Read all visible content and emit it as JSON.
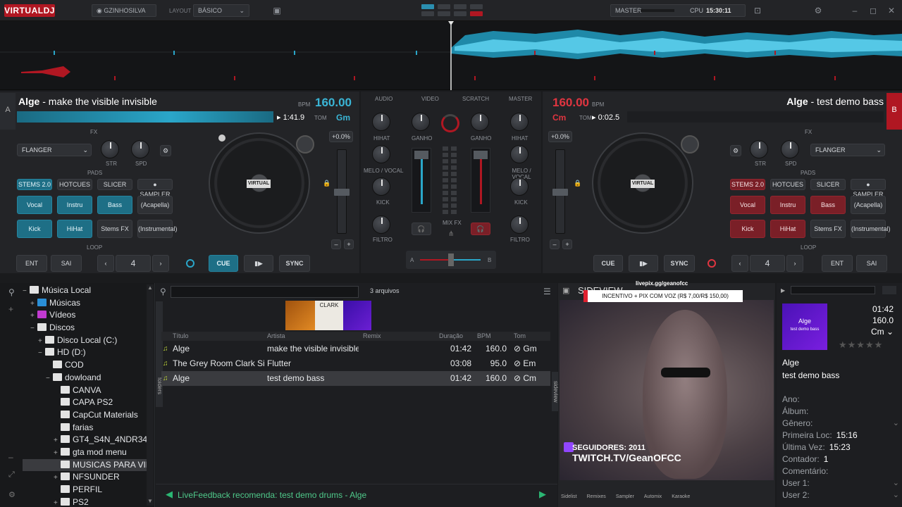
{
  "app": {
    "logo": "VIRTUALDJ"
  },
  "topbar": {
    "user": "GZINHOSILVA",
    "layout_label": "LAYOUT",
    "layout_value": "BÁSICO",
    "master_label": "MASTER",
    "cpu_label": "CPU",
    "clock": "15:30:11"
  },
  "deckA": {
    "letter": "A",
    "artist": "Alge",
    "title": " - make the visible invisible",
    "bpm_label": "BPM",
    "bpm": "160.00",
    "time": "1:41.9",
    "key_label": "TOM",
    "key": "Gm",
    "pitch": "+0.0%",
    "fx_label": "FX",
    "fx_effect": "FLANGER",
    "str": "STR",
    "spd": "SPD",
    "pads_label": "PADS",
    "pad_modes": [
      "STEMS 2.0",
      "HOTCUES",
      "SLICER",
      "SAMPLER"
    ],
    "pads": [
      "Vocal",
      "Instru",
      "Bass",
      "(Acapella)",
      "Kick",
      "HiHat",
      "Stems FX",
      "(Instrumental)"
    ],
    "loop_label": "LOOP",
    "ent": "ENT",
    "sai": "SAI",
    "loop_size": "4",
    "cue": "CUE",
    "sync": "SYNC"
  },
  "deckB": {
    "letter": "B",
    "artist": "Alge",
    "title": " - test demo bass",
    "bpm_label": "BPM",
    "bpm": "160.00",
    "time": "0:02.5",
    "key_label": "TOM",
    "key": "Cm",
    "pitch": "+0.0%",
    "fx_label": "FX",
    "fx_effect": "FLANGER",
    "str": "STR",
    "spd": "SPD",
    "pads_label": "PADS",
    "pad_modes": [
      "STEMS 2.0",
      "HOTCUES",
      "SLICER",
      "SAMPLER"
    ],
    "pads": [
      "Vocal",
      "Instru",
      "Bass",
      "(Acapella)",
      "Kick",
      "HiHat",
      "Stems FX",
      "(Instrumental)"
    ],
    "loop_label": "LOOP",
    "ent": "ENT",
    "sai": "SAI",
    "loop_size": "4",
    "cue": "CUE",
    "sync": "SYNC"
  },
  "mixer": {
    "tabs": [
      "AUDIO",
      "VIDEO",
      "SCRATCH",
      "MASTER"
    ],
    "hihat": "HIHAT",
    "ganho": "GANHO",
    "melo": "MELO / VOCAL",
    "kick": "KICK",
    "filtro": "FILTRO",
    "mixfx": "MIX FX",
    "cross_a": "A",
    "cross_b": "B"
  },
  "browser": {
    "tree": [
      {
        "label": "Música Local",
        "indent": 0,
        "exp": "−"
      },
      {
        "label": "Músicas",
        "indent": 1,
        "exp": "+"
      },
      {
        "label": "Vídeos",
        "indent": 1,
        "exp": "+"
      },
      {
        "label": "Discos",
        "indent": 1,
        "exp": "−"
      },
      {
        "label": "Disco Local (C:)",
        "indent": 2,
        "exp": "+"
      },
      {
        "label": "HD (D:)",
        "indent": 2,
        "exp": "−"
      },
      {
        "label": "COD",
        "indent": 3,
        "exp": ""
      },
      {
        "label": "dowloand",
        "indent": 3,
        "exp": "−"
      },
      {
        "label": "CANVA",
        "indent": 4,
        "exp": ""
      },
      {
        "label": "CAPA PS2",
        "indent": 4,
        "exp": ""
      },
      {
        "label": "CapCut Materials",
        "indent": 4,
        "exp": ""
      },
      {
        "label": "farias",
        "indent": 4,
        "exp": ""
      },
      {
        "label": "GT4_S4N_4NDR34S",
        "indent": 4,
        "exp": "+"
      },
      {
        "label": "gta mod menu",
        "indent": 4,
        "exp": "+"
      },
      {
        "label": "MUSICAS PARA VIDEO",
        "indent": 4,
        "exp": ""
      },
      {
        "label": "NFSUNDER",
        "indent": 4,
        "exp": "+"
      },
      {
        "label": "PERFIL",
        "indent": 4,
        "exp": ""
      },
      {
        "label": "PS2",
        "indent": 4,
        "exp": "+"
      }
    ],
    "file_count": "3 arquivos",
    "folders_tab": "folders",
    "sideview_tab": "sideview",
    "columns": {
      "title": "Título",
      "artist": "Artista",
      "remix": "Remix",
      "duration": "Duração",
      "bpm": "BPM",
      "key": "Tom"
    },
    "rows": [
      {
        "title": "Alge",
        "artist": "make the visible invisible",
        "remix": "",
        "duration": "01:42",
        "bpm": "160.0",
        "key": "⊘ Gm"
      },
      {
        "title": "The Grey Room   Clark Sims",
        "artist": "Flutter",
        "remix": "",
        "duration": "03:08",
        "bpm": "95.0",
        "key": "⊘ Em"
      },
      {
        "title": "Alge",
        "artist": "test demo bass",
        "remix": "",
        "duration": "01:42",
        "bpm": "160.0",
        "key": "⊘ Cm"
      }
    ],
    "livefeedback": "LiveFeedback recomenda: test demo drums - Alge"
  },
  "sideview": {
    "title": "SIDEVIEW",
    "overlay_url": "livepix.gg/geanofcc",
    "overlay_banner": "INCENTIVO + PIX COM VOZ (R$ 7,00/R$ 150,00)",
    "followers": "SEGUIDORES: 2011",
    "channel": "TWITCH.TV/GeanOFCC",
    "bottom_tabs": [
      "Sidelist",
      "Remixes",
      "Sampler",
      "Automix",
      "Karaoke"
    ]
  },
  "info": {
    "cover_artist": "Alge",
    "cover_title": "test demo bass",
    "duration": "01:42",
    "bpm": "160.0",
    "key": "Cm",
    "artist": "Alge",
    "title": "test demo bass",
    "fields": [
      {
        "label": "Ano:",
        "value": ""
      },
      {
        "label": "Álbum:",
        "value": ""
      },
      {
        "label": "Gênero:",
        "value": ""
      },
      {
        "label": "Primeira Loc:",
        "value": "15:16"
      },
      {
        "label": "Última Vez:",
        "value": "15:23"
      },
      {
        "label": "Contador:",
        "value": "1"
      },
      {
        "label": "Comentário:",
        "value": ""
      },
      {
        "label": "User 1:",
        "value": ""
      },
      {
        "label": "User 2:",
        "value": ""
      }
    ]
  },
  "colors": {
    "accent_blue": "#1e6f86",
    "accent_red": "#b01722",
    "wave_blue": "#2aa6c9",
    "bg": "#1a1b1d"
  }
}
